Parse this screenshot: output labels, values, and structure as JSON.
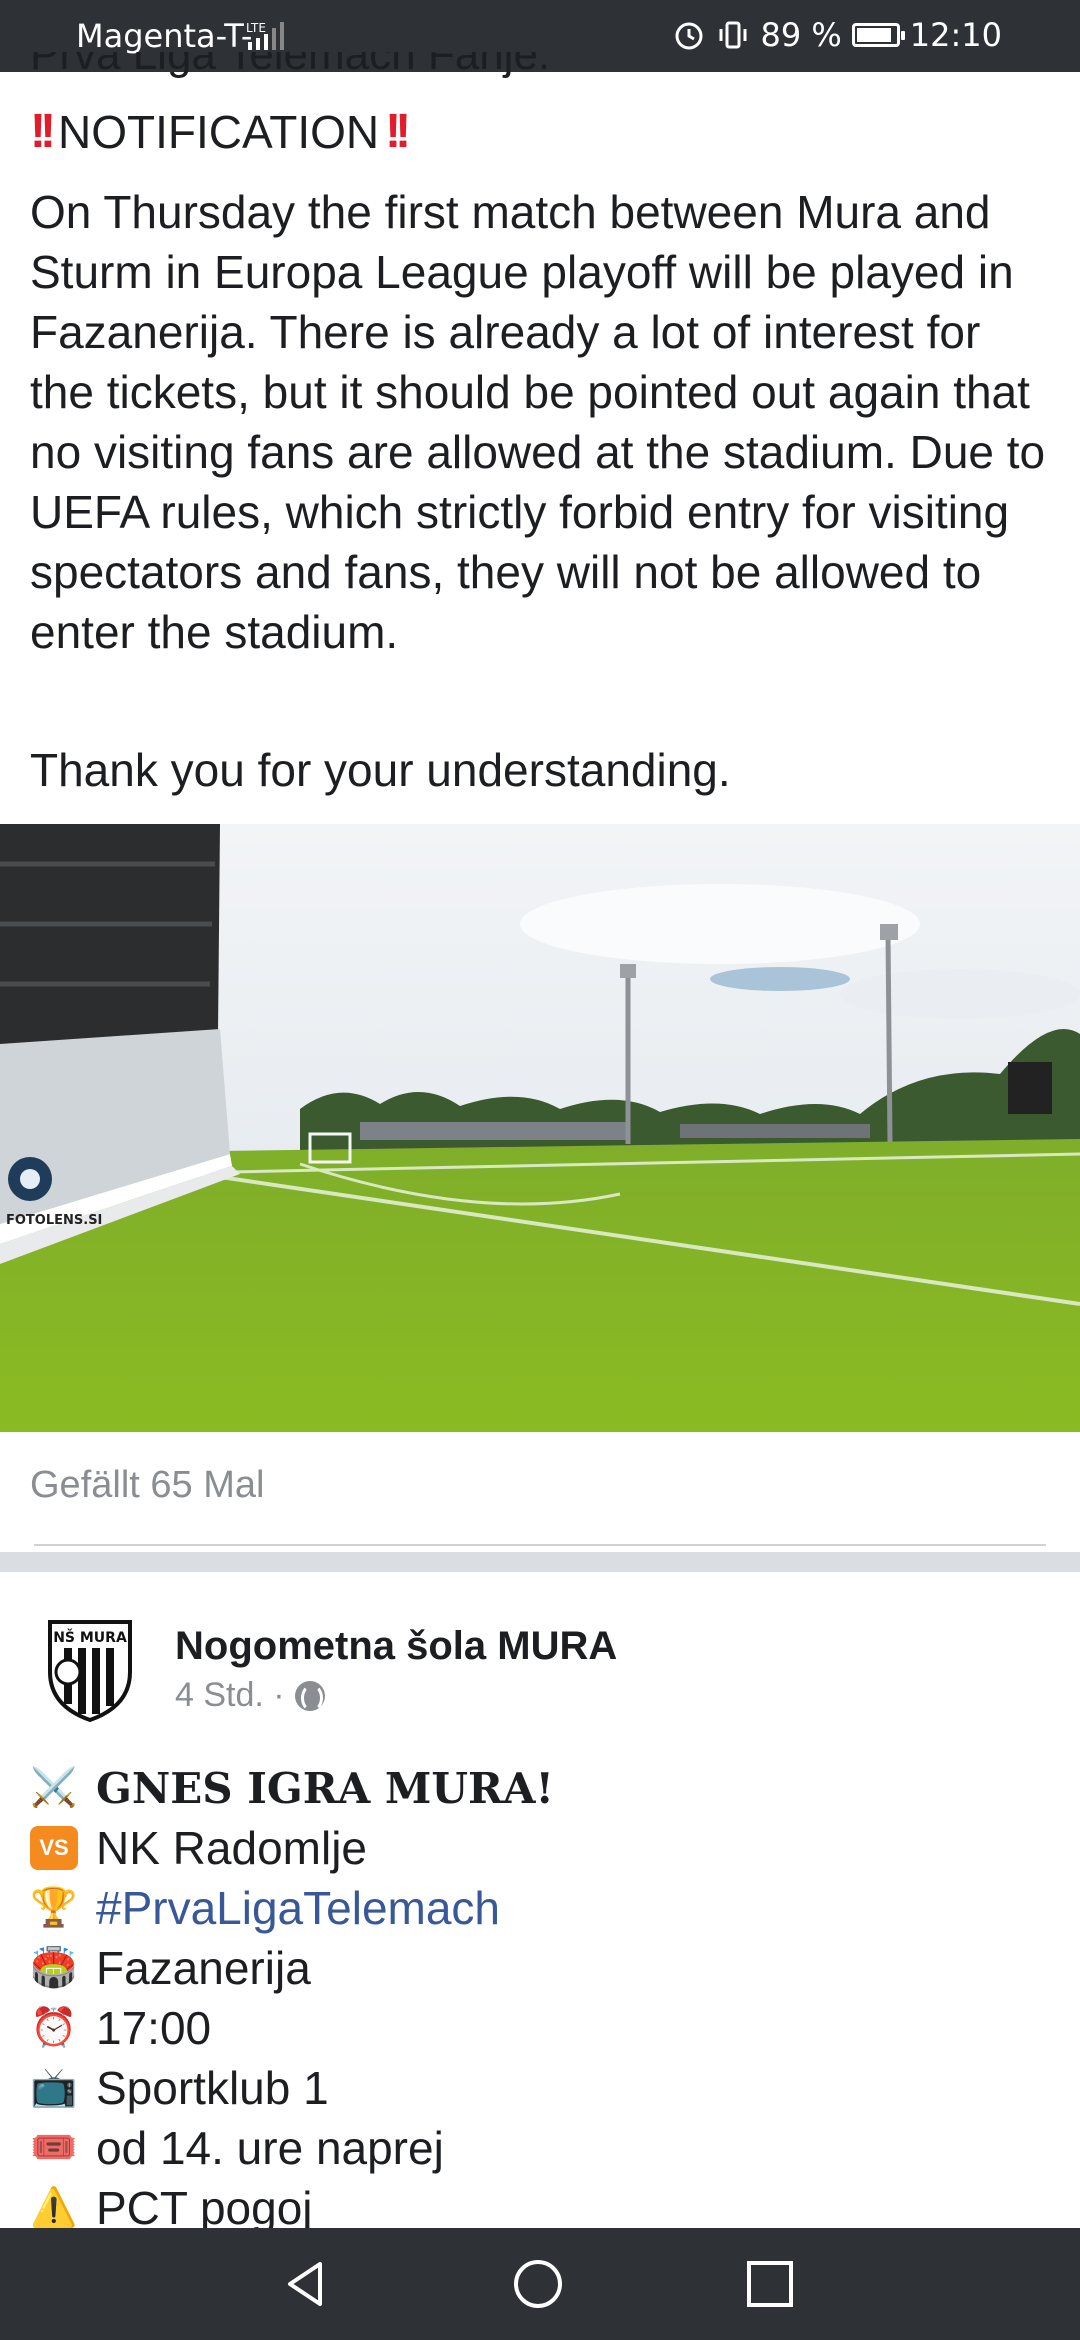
{
  "status_bar": {
    "carrier": "Magenta-T-",
    "network": "LTE",
    "battery_percent": "89 %",
    "battery_level": 0.89,
    "time": "12:10"
  },
  "post1": {
    "cut_heading": "Prva Liga Telemach Fanje:",
    "notification_label": "NOTIFICATION",
    "body": "On Thursday the first match between Mura and Sturm in Europa League playoff will be played in Fazanerija. There is already a lot of interest for the tickets, but it should be pointed out again that no visiting fans are allowed at the stadium. Due to UEFA rules, which strictly forbid entry for visiting spectators and fans, they will not be allowed to enter the stadium.",
    "thanks": "Thank you for your understanding.",
    "photo_watermark": "FOTOLENS.SI",
    "likes": "Gefällt 65 Mal"
  },
  "post2": {
    "page_name": "Nogometna šola MURA",
    "avatar_text": "NŠ MURA",
    "time": "4 Std. ·",
    "lines": [
      {
        "icon": "crossed-swords-icon",
        "glyph": "⚔️",
        "text": "𝐆𝐍𝐄𝐒 𝐈𝐆𝐑𝐀 𝐌𝐔𝐑𝐀!"
      },
      {
        "icon": "vs-icon",
        "glyph": "VS",
        "text": "NK Radomlje"
      },
      {
        "icon": "trophy-icon",
        "glyph": "🏆",
        "text": "#PrvaLigaTelemach"
      },
      {
        "icon": "stadium-icon",
        "glyph": "🏟️",
        "text": "Fazanerija"
      },
      {
        "icon": "alarm-clock-icon",
        "glyph": "⏰",
        "text": "17:00"
      },
      {
        "icon": "tv-icon",
        "glyph": "📺",
        "text": "Sportklub 1"
      },
      {
        "icon": "ticket-icon",
        "glyph": "🎟️",
        "text": "od 14. ure naprej"
      },
      {
        "icon": "warning-icon",
        "glyph": "⚠️",
        "text": "PCT pogoj"
      }
    ]
  },
  "colors": {
    "status_bar": "#2e3136",
    "hashtag": "#385898",
    "muted_text": "#8a8d91",
    "notification_marks": "#e11d2b"
  },
  "nav": {
    "back": "back-icon",
    "home": "home-icon",
    "recents": "recents-icon"
  }
}
